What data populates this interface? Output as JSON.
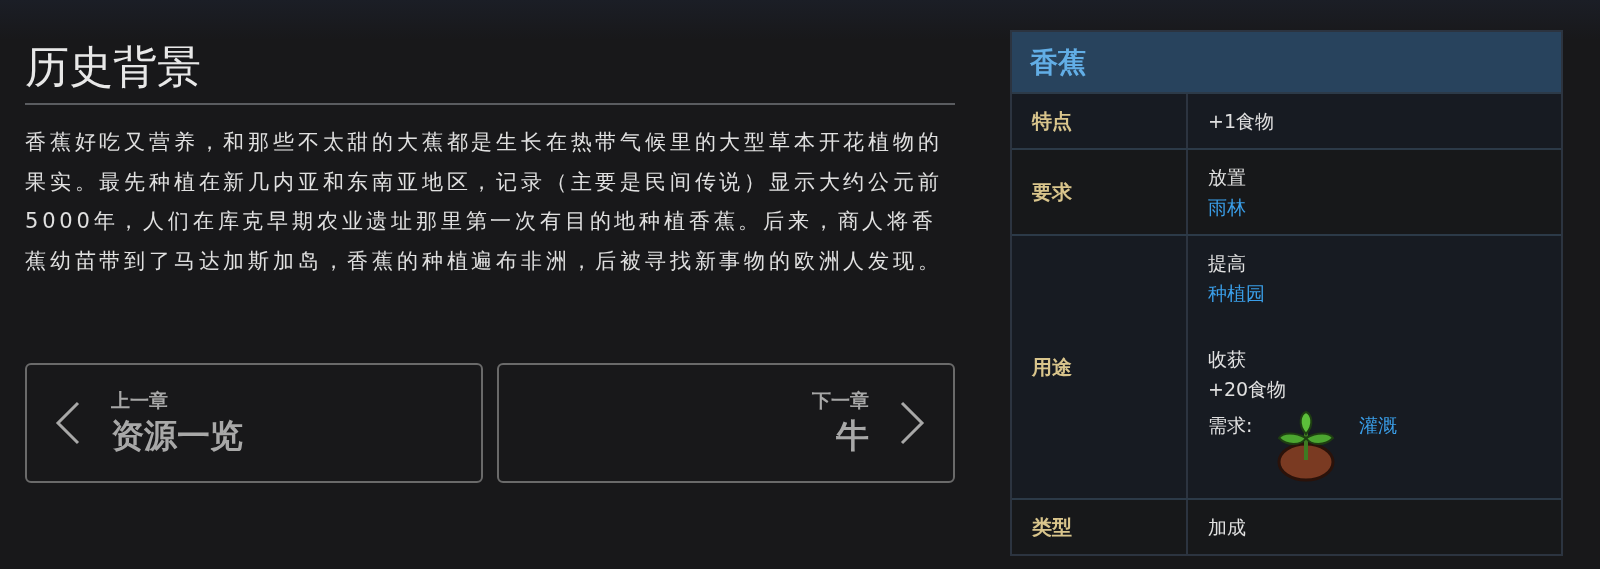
{
  "section": {
    "title": "历史背景",
    "paragraph": "香蕉好吃又营养，和那些不太甜的大蕉都是生长在热带气候里的大型草本开花植物的果实。最先种植在新几内亚和东南亚地区，记录（主要是民间传说）显示大约公元前5000年，人们在库克早期农业遗址那里第一次有目的地种植香蕉。后来，商人将香蕉幼苗带到了马达加斯加岛，香蕉的种植遍布非洲，后被寻找新事物的欧洲人发现。"
  },
  "navigation": [
    {
      "kind": "prev",
      "caption": "上一章",
      "title": "资源一览"
    },
    {
      "kind": "next",
      "caption": "下一章",
      "title": "牛"
    }
  ],
  "infobox": {
    "title": "香蕉",
    "rows": [
      {
        "label": "特点",
        "lines": [
          {
            "kind": "text",
            "text": "+1食物"
          }
        ]
      },
      {
        "label": "要求",
        "lines": [
          {
            "kind": "text",
            "text": "放置"
          },
          {
            "kind": "link",
            "text": "雨林"
          }
        ]
      },
      {
        "label": "用途",
        "lines": [
          {
            "kind": "text",
            "text": "提高"
          },
          {
            "kind": "link",
            "text": "种植园"
          },
          {
            "kind": "gap"
          },
          {
            "kind": "text",
            "text": "收获"
          },
          {
            "kind": "text",
            "text": "+20食物"
          },
          {
            "kind": "need",
            "text": "需求:",
            "link": "灌溉"
          }
        ]
      },
      {
        "label": "类型",
        "lines": [
          {
            "kind": "text",
            "text": "加成"
          }
        ]
      }
    ]
  }
}
